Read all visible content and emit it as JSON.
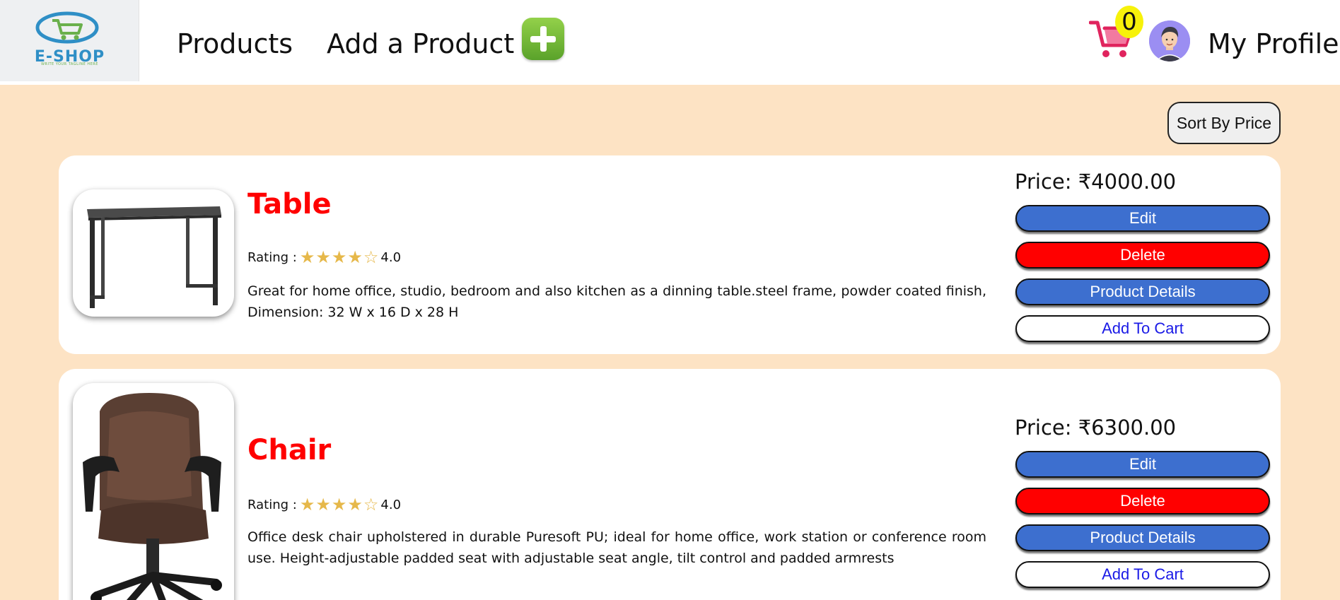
{
  "header": {
    "logo_text": "E-SHOP",
    "logo_tagline": "WRITE YOUR TAGLINE HERE",
    "nav_products": "Products",
    "nav_add_product": "Add a Product",
    "cart_count": "0",
    "nav_profile": "My Profile"
  },
  "toolbar": {
    "sort_label": "Sort By Price"
  },
  "products": [
    {
      "title": "Table",
      "rating_label": "Rating :",
      "stars": "★★★★☆",
      "rating_value": "4.0",
      "description": "Great for home office, studio, bedroom and also kitchen as a dinning table.steel frame, powder coated finish, Dimension: 32 W x 16 D x 28 H",
      "price": "Price: ₹4000.00",
      "edit_label": "Edit",
      "delete_label": "Delete",
      "details_label": "Product Details",
      "cart_label": "Add To Cart"
    },
    {
      "title": "Chair",
      "rating_label": "Rating :",
      "stars": "★★★★☆",
      "rating_value": "4.0",
      "description": "Office desk chair upholstered in durable Puresoft PU; ideal for home office, work station or conference room use. Height-adjustable padded seat with adjustable seat angle, tilt control and padded armrests",
      "price": "Price: ₹6300.00",
      "edit_label": "Edit",
      "delete_label": "Delete",
      "details_label": "Product Details",
      "cart_label": "Add To Cart"
    }
  ],
  "colors": {
    "page_background": "#fde3c4",
    "title_red": "#ff0000",
    "button_blue": "#3d6fcf",
    "delete_red": "#ff0000",
    "star_gold": "#e6b84a",
    "badge_yellow": "#f7f20a"
  },
  "icons": [
    "shopping-cart-icon",
    "plus-icon",
    "avatar-icon"
  ]
}
